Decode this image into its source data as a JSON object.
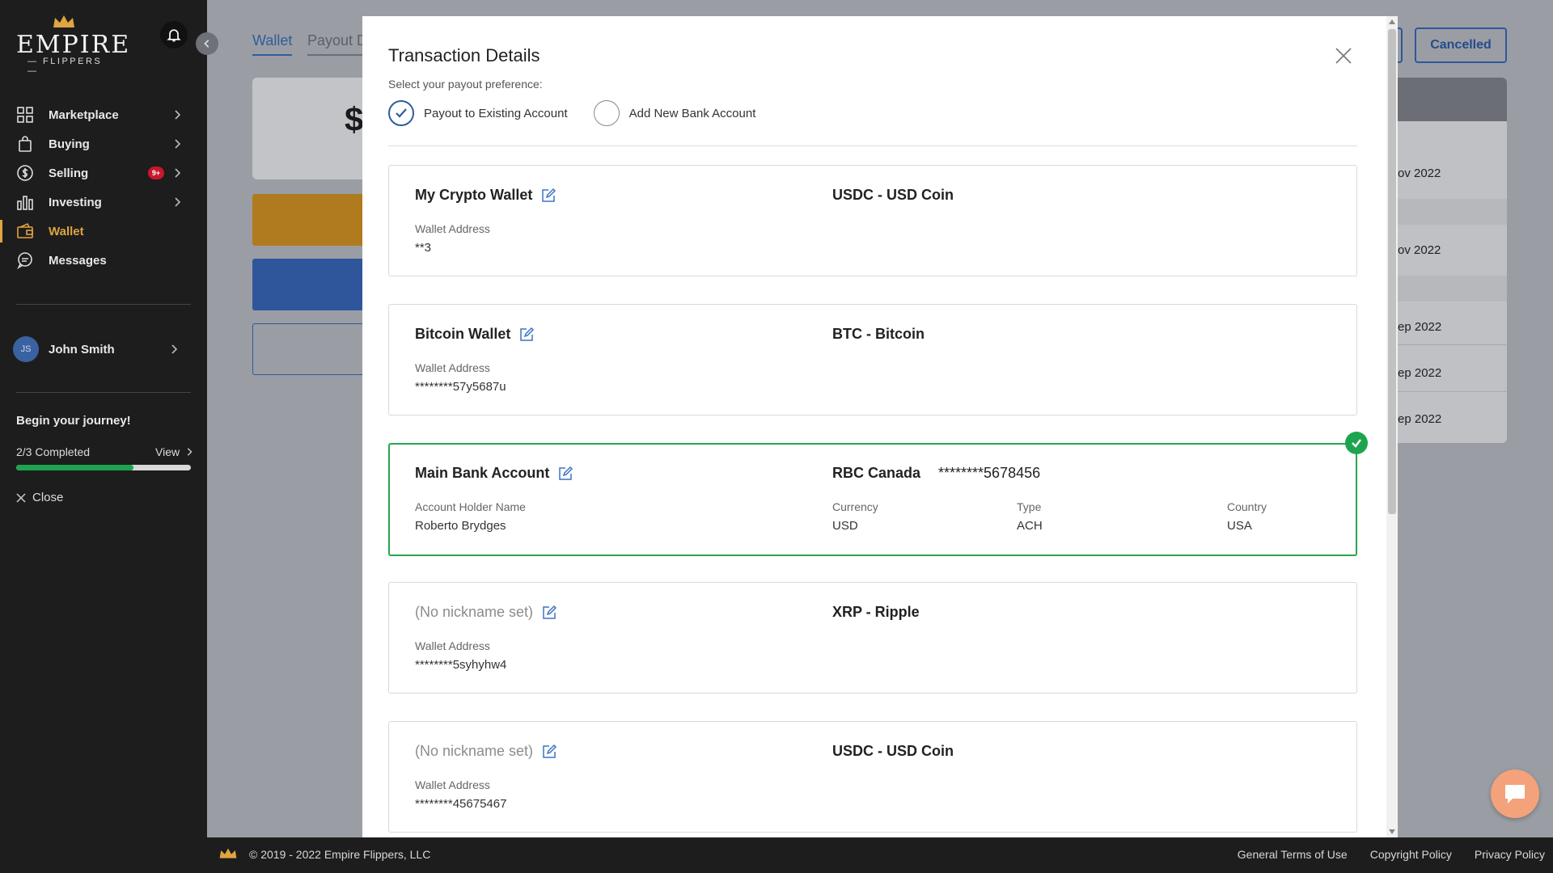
{
  "brand": {
    "name": "EMPIRE",
    "sub": "— FLIPPERS —"
  },
  "sidebar": {
    "items": [
      {
        "label": "Marketplace",
        "icon": "grid-icon"
      },
      {
        "label": "Buying",
        "icon": "shopping-bag-icon"
      },
      {
        "label": "Selling",
        "icon": "dollar-circle-icon",
        "badge": "9+"
      },
      {
        "label": "Investing",
        "icon": "bar-chart-icon"
      },
      {
        "label": "Wallet",
        "icon": "wallet-icon",
        "active": true
      },
      {
        "label": "Messages",
        "icon": "chat-bubble-icon"
      }
    ],
    "user": {
      "initials": "JS",
      "name": "John Smith"
    },
    "journey": {
      "title": "Begin your journey!",
      "progress_text": "2/3 Completed",
      "view_label": "View",
      "progress": 0.67
    },
    "close_label": "Close"
  },
  "background": {
    "tabs": [
      "Wallet",
      "Payout D"
    ],
    "dollar": "$",
    "cancelled_label": "Cancelled",
    "dates": [
      "ov 2022",
      "ov 2022",
      "ep 2022",
      "ep 2022",
      "ep 2022"
    ]
  },
  "modal": {
    "title": "Transaction Details",
    "pref_label": "Select your payout preference:",
    "options": [
      "Payout to Existing Account",
      "Add New Bank Account"
    ],
    "selected_option": 0,
    "accounts": [
      {
        "name": "My Crypto Wallet",
        "type": "USDC - USD Coin",
        "field_label": "Wallet Address",
        "field_value": "**3"
      },
      {
        "name": "Bitcoin Wallet",
        "type": "BTC - Bitcoin",
        "field_label": "Wallet Address",
        "field_value": "********57y5687u"
      },
      {
        "name": "Main Bank Account",
        "type": "RBC Canada",
        "number": "********5678456",
        "holder_label": "Account Holder Name",
        "holder_value": "Roberto Brydges",
        "currency_label": "Currency",
        "currency_value": "USD",
        "type_label": "Type",
        "type_value": "ACH",
        "country_label": "Country",
        "country_value": "USA",
        "selected": true
      },
      {
        "name": "(No nickname set)",
        "type": "XRP - Ripple",
        "field_label": "Wallet Address",
        "field_value": "********5syhyhw4"
      },
      {
        "name": "(No nickname set)",
        "type": "USDC - USD Coin",
        "field_label": "Wallet Address",
        "field_value": "********45675467"
      }
    ]
  },
  "footer": {
    "copyright": "© 2019 - 2022 Empire Flippers, LLC",
    "links": [
      "General Terms of Use",
      "Copyright Policy",
      "Privacy Policy"
    ]
  },
  "colors": {
    "accent": "#e0a440",
    "primary": "#2f5d9c",
    "success": "#1ea44f",
    "sidebar": "#1d1d1d"
  }
}
